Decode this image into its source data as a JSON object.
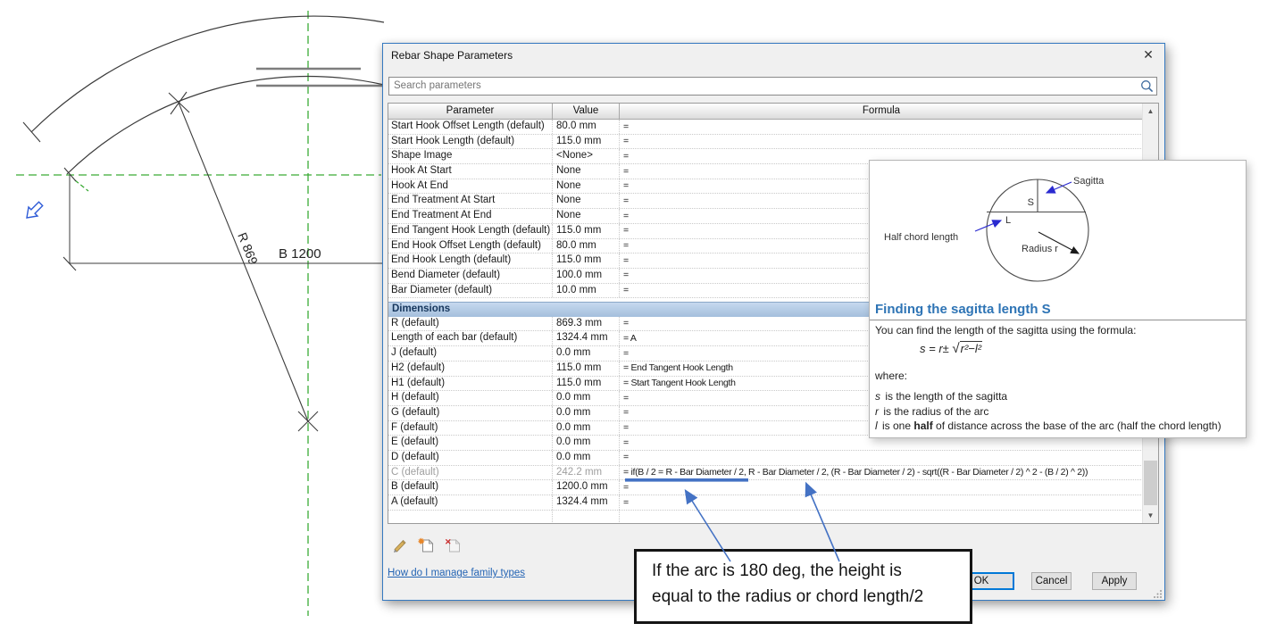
{
  "colors": {
    "accent_blue": "#4472c4",
    "ref_plane_green": "#3aaa35",
    "heading_blue": "#2e74b5",
    "link_blue": "#2464b4",
    "ok_border_blue": "#0078d7",
    "section_header_bg": "#aec7e2"
  },
  "background": {
    "radius_label": "R 869",
    "chord_label": "B 1200"
  },
  "dialog": {
    "title": "Rebar Shape Parameters",
    "close_glyph": "✕",
    "search_placeholder": "Search parameters",
    "table": {
      "headers": {
        "param": "Parameter",
        "value": "Value",
        "formula": "Formula"
      },
      "rows": [
        {
          "param": "Start Hook Offset Length (default)",
          "value": "80.0 mm",
          "formula": ""
        },
        {
          "param": "Start Hook Length (default)",
          "value": "115.0 mm",
          "formula": ""
        },
        {
          "param": "Shape Image",
          "value": "<None>",
          "formula": ""
        },
        {
          "param": "Hook At Start",
          "value": "None",
          "formula": ""
        },
        {
          "param": "Hook At End",
          "value": "None",
          "formula": ""
        },
        {
          "param": "End Treatment At Start",
          "value": "None",
          "formula": ""
        },
        {
          "param": "End Treatment At End",
          "value": "None",
          "formula": ""
        },
        {
          "param": "End Tangent Hook Length (default)",
          "value": "115.0 mm",
          "formula": ""
        },
        {
          "param": "End Hook Offset Length (default)",
          "value": "80.0 mm",
          "formula": ""
        },
        {
          "param": "End Hook Length (default)",
          "value": "115.0 mm",
          "formula": ""
        },
        {
          "param": "Bend Diameter (default)",
          "value": "100.0 mm",
          "formula": ""
        },
        {
          "param": "Bar Diameter (default)",
          "value": "10.0 mm",
          "formula": ""
        }
      ],
      "section_header": "Dimensions",
      "dim_rows": [
        {
          "param": "R (default)",
          "value": "869.3 mm",
          "formula": ""
        },
        {
          "param": "Length of each bar (default)",
          "value": "1324.4 mm",
          "formula": "A"
        },
        {
          "param": "J (default)",
          "value": "0.0 mm",
          "formula": ""
        },
        {
          "param": "H2 (default)",
          "value": "115.0 mm",
          "formula": "End Tangent Hook Length"
        },
        {
          "param": "H1 (default)",
          "value": "115.0 mm",
          "formula": "Start Tangent Hook Length"
        },
        {
          "param": "H (default)",
          "value": "0.0 mm",
          "formula": ""
        },
        {
          "param": "G (default)",
          "value": "0.0 mm",
          "formula": ""
        },
        {
          "param": "F (default)",
          "value": "0.0 mm",
          "formula": ""
        },
        {
          "param": "E (default)",
          "value": "0.0 mm",
          "formula": ""
        },
        {
          "param": "D (default)",
          "value": "0.0 mm",
          "formula": ""
        },
        {
          "param": "C (default)",
          "value": "242.2 mm",
          "formula": "if(B / 2 = R - Bar Diameter / 2, R - Bar Diameter / 2, (R - Bar Diameter / 2) - sqrt((R - Bar Diameter / 2) ^ 2 - (B / 2) ^ 2))",
          "disabled": true
        },
        {
          "param": "B (default)",
          "value": "1200.0 mm",
          "formula": ""
        },
        {
          "param": "A (default)",
          "value": "1324.4 mm",
          "formula": ""
        }
      ]
    },
    "help_link": "How do I manage family types",
    "buttons": {
      "ok": "OK",
      "cancel": "Cancel",
      "apply": "Apply"
    }
  },
  "sagitta_panel": {
    "diagram_labels": {
      "sagitta": "Sagitta",
      "s": "S",
      "l": "L",
      "half_chord": "Half chord length",
      "radius": "Radius r"
    },
    "heading": "Finding the sagitta length S",
    "intro": "You can find the length of the sagitta using the formula:",
    "formula_lhs": "s = r±",
    "formula_radicand": "r²−l²",
    "where_label": "where:",
    "definitions": [
      {
        "var": "s",
        "text": "is the length of the sagitta"
      },
      {
        "var": "r",
        "text": "is the radius of the arc"
      },
      {
        "var": "l",
        "pre": "is one",
        "bold": "half",
        "post": "of distance across the base of the arc (half the chord length)"
      }
    ]
  },
  "callout": {
    "line1": "If the arc is 180 deg, the height is",
    "line2": "equal to the radius or chord length/2"
  }
}
